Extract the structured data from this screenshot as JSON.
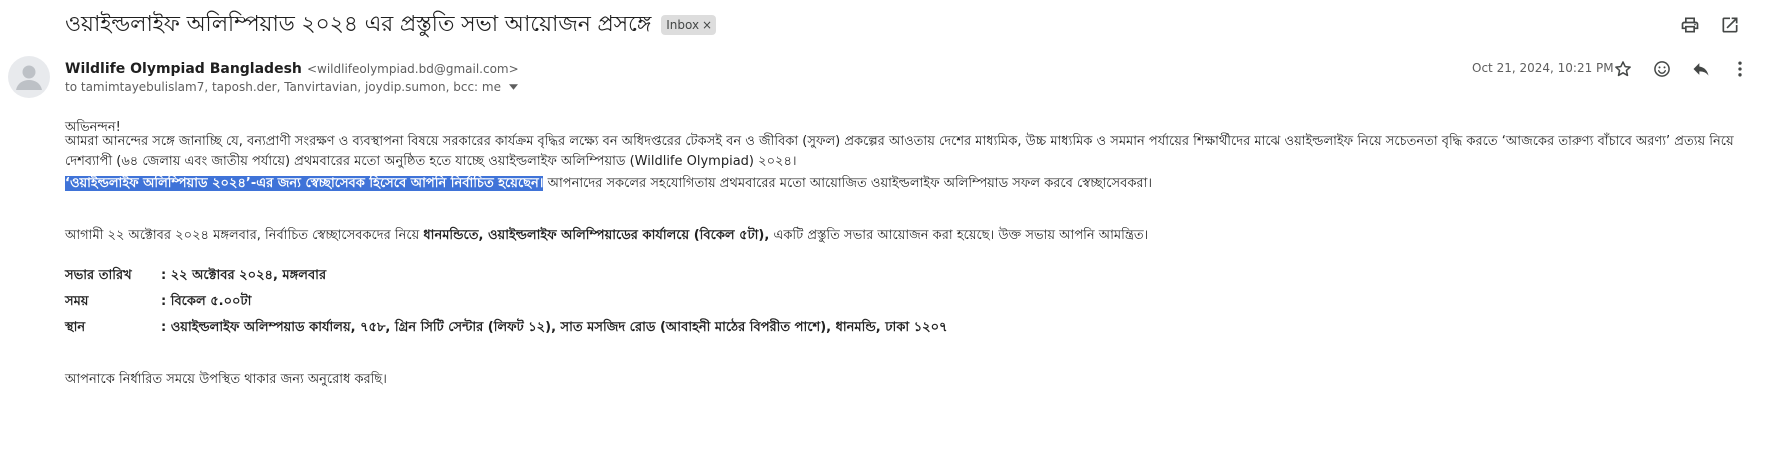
{
  "subject": "ওয়াইল্ডলাইফ অলিম্পিয়াড ২০২৪ এর প্রস্তুতি সভা আয়োজন প্রসঙ্গে",
  "label_chip": "Inbox",
  "sender": {
    "name": "Wildlife Olympiad Bangladesh",
    "email": "<wildlifeolympiad.bd@gmail.com>",
    "recipients": "to tamimtayebulislam7, taposh.der, Tanvirtavian, joydip.sumon, bcc: me"
  },
  "date": "Oct 21, 2024, 10:21 PM",
  "icons": {
    "print": "print-icon",
    "open_new_window": "open-in-new-icon",
    "star": "star-icon",
    "emoji": "emoji-icon",
    "reply": "reply-icon",
    "more": "more-vert-icon",
    "avatar": "avatar-person-icon"
  },
  "body": {
    "greeting": "অভিনন্দন!",
    "para1": "আমরা আনন্দের সঙ্গে জানাচ্ছি যে,  বন্যপ্রাণী সংরক্ষণ ও ব্যবস্থাপনা বিষয়ে সরকারের কার্যক্রম বৃদ্ধির লক্ষ্যে বন অধিদপ্তরের টেকসই বন ও জীবিকা (সুফল) প্রকল্পের আওতায় দেশের মাধ্যমিক, উচ্চ মাধ্যমিক ও সমমান পর্যায়ের শিক্ষার্থীদের মাঝে ওয়াইল্ডলাইফ নিয়ে সচেতনতা বৃদ্ধি করতে ‘আজকের তারুণ্য বাঁচাবে অরণ্য’ প্রত্যয় নিয়ে দেশব্যাপী (৬৪ জেলায় এবং জাতীয় পর্যায়ে) প্রথমবারের মতো অনুষ্ঠিত হতে যাচ্ছে ওয়াইল্ডলাইফ অলিম্পিয়াড (Wildlife Olympiad) ২০২৪।",
    "para2_highlight": "‘ওয়াইল্ডলাইফ অলিম্পিয়াড ২০২৪’-এর জন্য স্বেচ্ছাসেবক হিসেবে আপনি নির্বাচিত হয়েছেন।",
    "para2_rest": " আপনাদের সকলের সহযোগিতায় প্রথমবারের মতো আয়োজিত ওয়াইল্ডলাইফ অলিম্পিয়াড সফল করবে স্বেচ্ছাসেবকরা।",
    "para3_a": "আগামী ২২ অক্টোবর ২০২৪ মঙ্গলবার, নির্বাচিত স্বেচ্ছাসেবকদের নিয়ে ",
    "para3_bold": "ধানমন্ডিতে, ওয়াইল্ডলাইফ অলিম্পিয়াডের কার্যালয়ে (বিকেল ৫টা),",
    "para3_b": " একটি প্রস্তুতি সভার আয়োজন করা হয়েছে। উক্ত সভায় আপনি আমন্ত্রিত।",
    "meeting_date_label": "সভার তারিখ",
    "meeting_date_value": ": ২২ অক্টোবর ২০২৪, মঙ্গলবার",
    "time_label": "সময়",
    "time_value": ":  বিকেল ৫.০০টা",
    "place_label": "স্থান",
    "place_value": ":  ওয়াইল্ডলাইফ অলিম্পয়াড কার্যালয়,  ৭৫৮, গ্রিন সিটি সেন্টার (লিফট ১২), সাত মসজিদ রোড (আবাহনী মাঠের বিপরীত পাশে), ধানমন্ডি, ঢাকা ১২০৭",
    "closing": "আপনাকে নির্ধারিত সময়ে উপস্থিত থাকার জন্য অনুরোধ করছি।"
  }
}
